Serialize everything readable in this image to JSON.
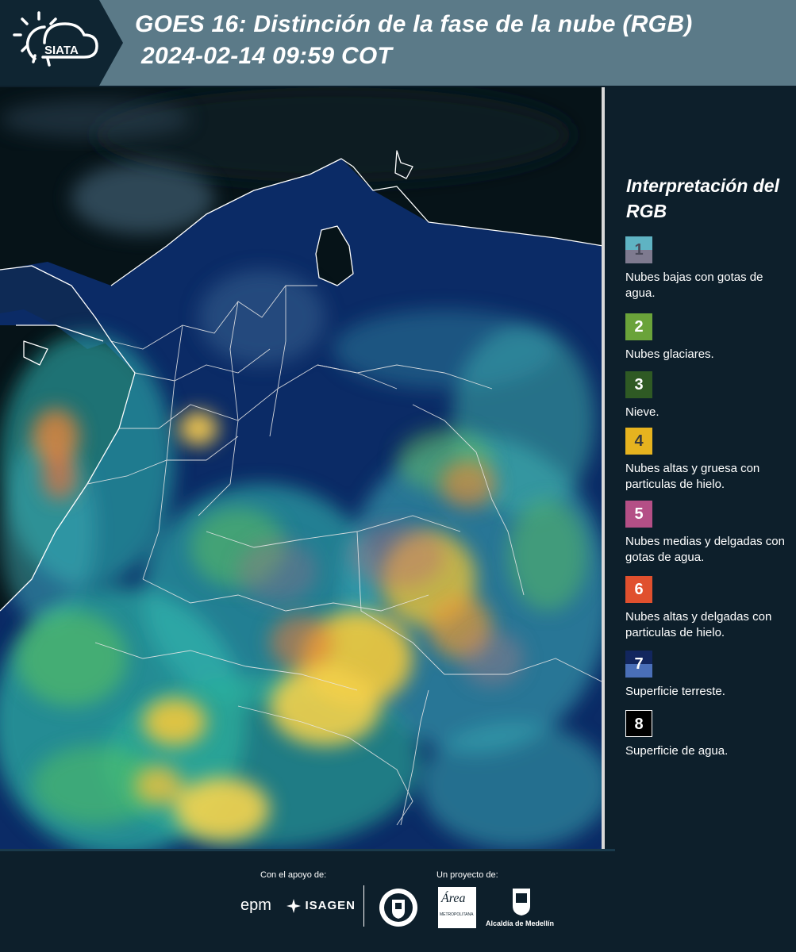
{
  "header": {
    "logo_text": "SIATA",
    "title_line1": "GOES 16: Distinción de la fase de la nube (RGB)",
    "title_line2": "2024-02-14 09:59 COT"
  },
  "legend": {
    "title": "Interpretación del RGB",
    "items": [
      {
        "num": "1",
        "desc": "Nubes bajas con gotas de agua.",
        "color_top": "#5fb3c3",
        "color_bottom": "#7e7a8f"
      },
      {
        "num": "2",
        "desc": "Nubes glaciares.",
        "color_top": "#6aa33a",
        "color_bottom": "#6aa33a"
      },
      {
        "num": "3",
        "desc": "Nieve.",
        "color_top": "#2f5a24",
        "color_bottom": "#2f5a24"
      },
      {
        "num": "4",
        "desc": "Nubes altas y gruesa con particulas de hielo.",
        "color_top": "#e6b31f",
        "color_bottom": "#e6b31f"
      },
      {
        "num": "5",
        "desc": "Nubes medias y delgadas con gotas de agua.",
        "color_top": "#b44f86",
        "color_bottom": "#b44f86"
      },
      {
        "num": "6",
        "desc": "Nubes altas y delgadas con particulas de hielo.",
        "color_top": "#e0502e",
        "color_bottom": "#e0502e"
      },
      {
        "num": "7",
        "desc": "Superficie terreste.",
        "color_top": "#12265e",
        "color_bottom": "#4a6fb8"
      },
      {
        "num": "8",
        "desc": "Superficie de agua.",
        "color_top": "#000000",
        "color_bottom": "#000000"
      }
    ]
  },
  "footer": {
    "support_label": "Con el apoyo de:",
    "project_label": "Un proyecto de:",
    "sponsor_epm": "epm",
    "sponsor_isagen": "ISAGEN",
    "area_logo_text": "Área",
    "area_sub": "METROPOLITANA",
    "alcaldia": "Alcaldía de Medellín"
  },
  "colors": {
    "header_bg": "#5b7a88",
    "page_bg": "#0d1f2b",
    "land": "#0b2b66",
    "water": "#061318"
  }
}
